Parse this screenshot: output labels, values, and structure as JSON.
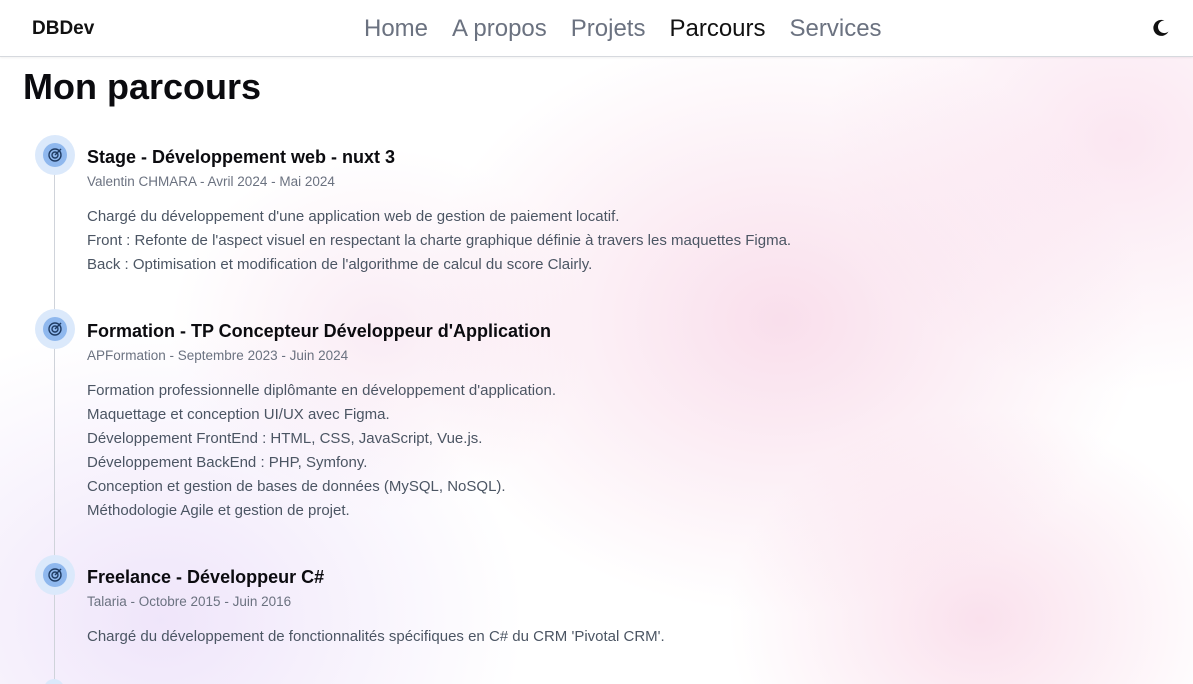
{
  "brand": "DBDev",
  "nav": {
    "links": [
      "Home",
      "A propos",
      "Projets",
      "Parcours",
      "Services"
    ],
    "active": "Parcours"
  },
  "page": {
    "title": "Mon parcours"
  },
  "icons": {
    "entry": "target-icon",
    "theme": "moon-icon"
  },
  "colors": {
    "accent": "#8fb8ee",
    "accent_bg": "#dbe9fb"
  },
  "timeline": [
    {
      "title": "Stage - Développement web - nuxt 3",
      "meta": "Valentin CHMARA - Avril 2024 - Mai 2024",
      "lines": [
        "Chargé du développement d'une application web de gestion de paiement locatif.",
        "Front : Refonte de l'aspect visuel en respectant la charte graphique définie à travers les maquettes Figma.",
        "Back : Optimisation et modification de l'algorithme de calcul du score Clairly."
      ]
    },
    {
      "title": "Formation - TP Concepteur Développeur d'Application",
      "meta": "APFormation - Septembre 2023 - Juin 2024",
      "lines": [
        "Formation professionnelle diplômante en développement d'application.",
        "Maquettage et conception UI/UX avec Figma.",
        "Développement FrontEnd : HTML, CSS, JavaScript, Vue.js.",
        "Développement BackEnd : PHP, Symfony.",
        "Conception et gestion de bases de données (MySQL, NoSQL).",
        "Méthodologie Agile et gestion de projet."
      ]
    },
    {
      "title": "Freelance - Développeur C#",
      "meta": "Talaria - Octobre 2015 - Juin 2016",
      "lines": [
        "Chargé du développement de fonctionnalités spécifiques en C# du CRM 'Pivotal CRM'."
      ]
    }
  ]
}
